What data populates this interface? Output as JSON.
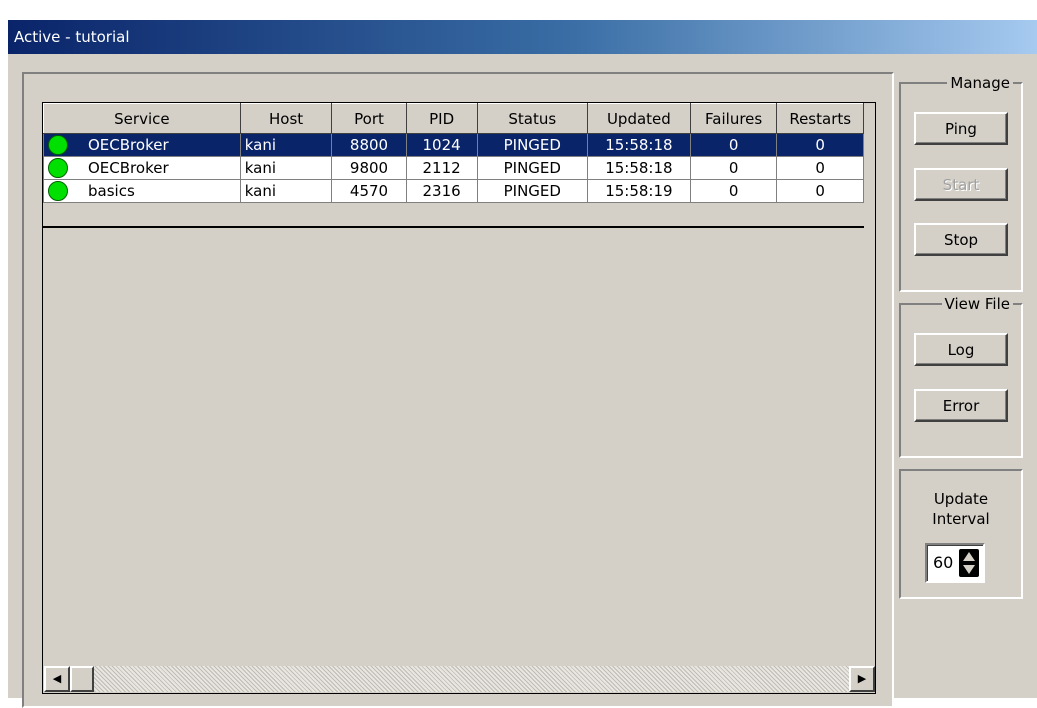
{
  "window": {
    "title": "Active - tutorial"
  },
  "table": {
    "columns": [
      "Service",
      "Host",
      "Port",
      "PID",
      "Status",
      "Updated",
      "Failures",
      "Restarts"
    ],
    "rows": [
      {
        "service": "OECBroker",
        "host": "kani",
        "port": "8800",
        "pid": "1024",
        "status": "PINGED",
        "updated": "15:58:18",
        "failures": "0",
        "restarts": "0",
        "selected": true,
        "indicator": "green-status-icon"
      },
      {
        "service": "OECBroker",
        "host": "kani",
        "port": "9800",
        "pid": "2112",
        "status": "PINGED",
        "updated": "15:58:18",
        "failures": "0",
        "restarts": "0",
        "selected": false,
        "indicator": "green-status-icon"
      },
      {
        "service": "basics",
        "host": "kani",
        "port": "4570",
        "pid": "2316",
        "status": "PINGED",
        "updated": "15:58:19",
        "failures": "0",
        "restarts": "0",
        "selected": false,
        "indicator": "green-status-icon"
      }
    ]
  },
  "manage": {
    "label": "Manage",
    "ping_label": "Ping",
    "start_label": "Start",
    "stop_label": "Stop"
  },
  "view_file": {
    "label": "View File",
    "log_label": "Log",
    "error_label": "Error"
  },
  "update_interval": {
    "label_line1": "Update",
    "label_line2": "Interval",
    "value": "60"
  },
  "scrollbar": {
    "left_arrow": "◀",
    "right_arrow": "▶"
  },
  "colors": {
    "selection": "#0a246a",
    "status_ok": "#00e000",
    "face": "#d4d0c8"
  }
}
